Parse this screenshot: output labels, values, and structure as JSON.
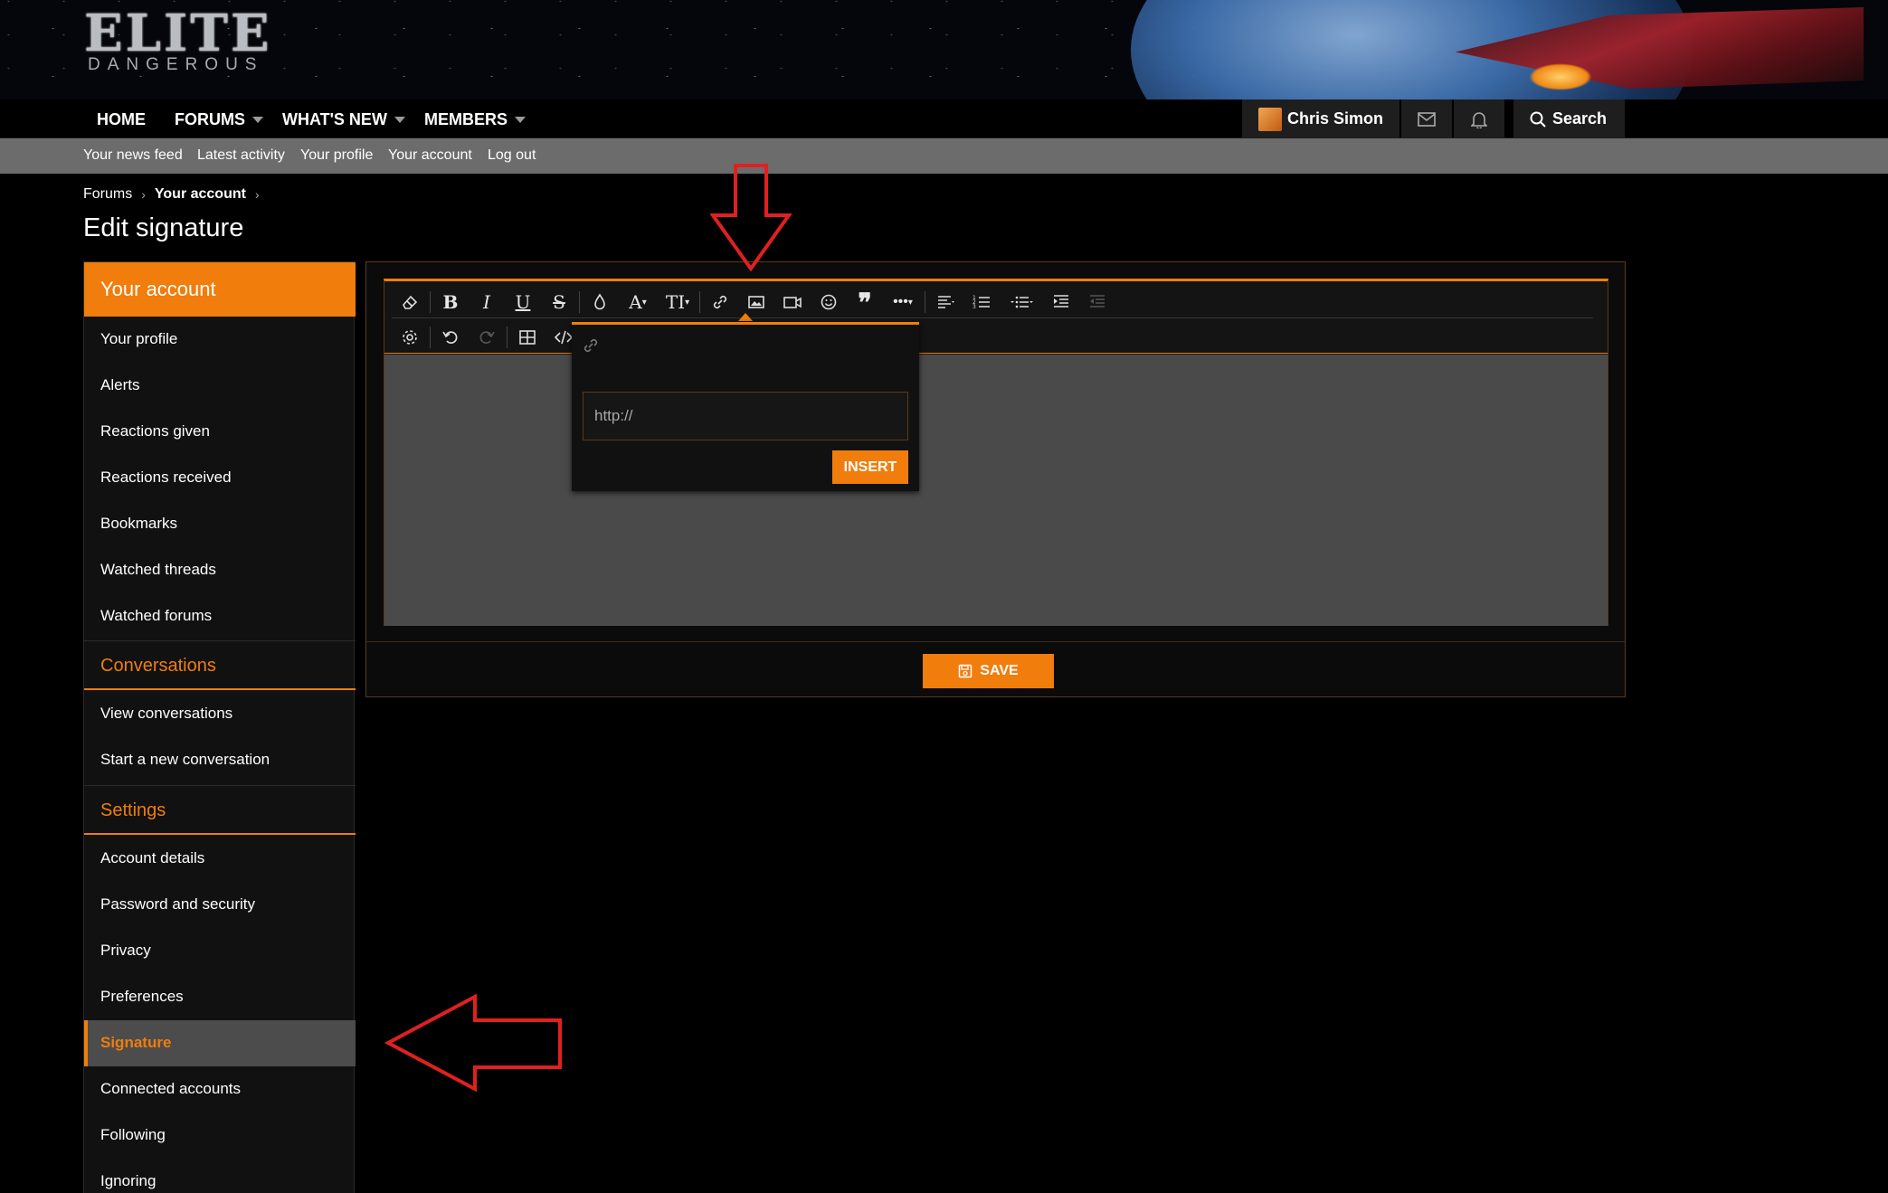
{
  "logo": {
    "main": "ELITE",
    "sub": "DANGEROUS"
  },
  "nav": {
    "items": [
      {
        "label": "HOME",
        "dropdown": false
      },
      {
        "label": "FORUMS",
        "dropdown": true
      },
      {
        "label": "WHAT'S NEW",
        "dropdown": true
      },
      {
        "label": "MEMBERS",
        "dropdown": true
      }
    ]
  },
  "user": {
    "name": "Chris Simon"
  },
  "search": {
    "label": "Search"
  },
  "subnav": {
    "items": [
      "Your news feed",
      "Latest activity",
      "Your profile",
      "Your account",
      "Log out"
    ]
  },
  "breadcrumb": {
    "items": [
      "Forums",
      "Your account"
    ]
  },
  "page": {
    "title": "Edit signature"
  },
  "sidebar": {
    "header": "Your account",
    "account_items": [
      "Your profile",
      "Alerts",
      "Reactions given",
      "Reactions received",
      "Bookmarks",
      "Watched threads",
      "Watched forums"
    ],
    "conversations_header": "Conversations",
    "conversation_items": [
      "View conversations",
      "Start a new conversation"
    ],
    "settings_header": "Settings",
    "settings_items": [
      "Account details",
      "Password and security",
      "Privacy",
      "Preferences",
      "Signature",
      "Connected accounts",
      "Following",
      "Ignoring"
    ],
    "active": "Signature"
  },
  "toolbar": {
    "row1": [
      "eraser-icon",
      "bold-icon",
      "italic-icon",
      "underline-icon",
      "strikethrough-icon",
      "text-color-icon",
      "font-family-icon",
      "font-size-icon",
      "link-icon",
      "image-icon",
      "video-icon",
      "smilie-icon",
      "quote-icon",
      "more-options-icon",
      "align-icon",
      "ordered-list-icon",
      "unordered-list-icon",
      "indent-icon",
      "outdent-icon"
    ],
    "row2": [
      "settings-icon",
      "undo-icon",
      "redo-icon",
      "table-icon",
      "code-icon"
    ]
  },
  "image_popup": {
    "placeholder": "http://",
    "insert_label": "INSERT"
  },
  "save": {
    "label": "SAVE"
  },
  "colors": {
    "accent": "#f07d0c",
    "subnav": "#6c6c6c",
    "annotation_arrow": "#e02020"
  }
}
